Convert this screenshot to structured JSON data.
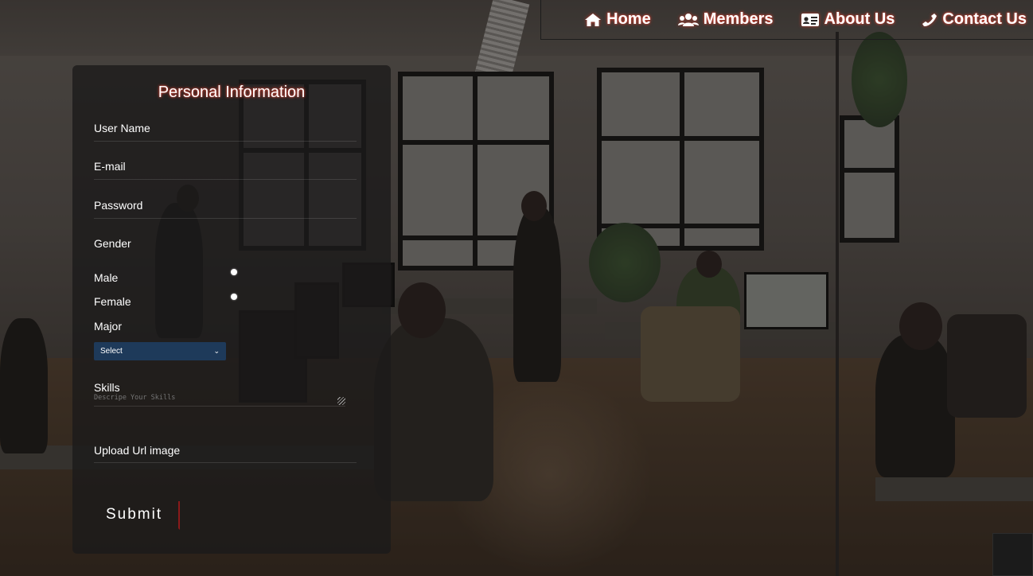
{
  "nav": {
    "items": [
      {
        "label": "Home",
        "icon": "home-icon"
      },
      {
        "label": "Members",
        "icon": "users-icon"
      },
      {
        "label": "About Us",
        "icon": "id-card-icon"
      },
      {
        "label": "Contact Us",
        "icon": "phone-icon"
      }
    ],
    "glow_color": "#c0392b"
  },
  "form": {
    "title": "Personal Information",
    "username_label": "User Name",
    "email_label": "E-mail",
    "password_label": "Password",
    "gender_label": "Gender",
    "male_label": "Male",
    "female_label": "Female",
    "major_label": "Major",
    "major_selected": "Select",
    "skills_label": "Skills",
    "skills_placeholder": "Descripe Your Skills",
    "upload_label": "Upload Url image",
    "submit_label": "Submit",
    "select_bg": "#1e3a5a"
  }
}
